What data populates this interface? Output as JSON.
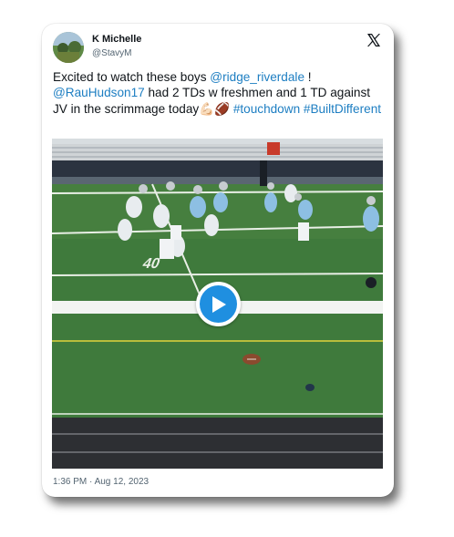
{
  "tweet": {
    "display_name": "K Michelle",
    "handle": "@StavyM",
    "text_parts": [
      {
        "text": "Excited to watch these boys ",
        "link": false
      },
      {
        "text": "@ridge_riverdale",
        "link": true
      },
      {
        "text": " ! ",
        "link": false
      },
      {
        "text": "@RauHudson17",
        "link": true
      },
      {
        "text": " had 2 TDs w freshmen and 1 TD against JV in the scrimmage today💪🏻🏈 ",
        "link": false
      },
      {
        "text": "#touchdown",
        "link": true
      },
      {
        "text": " ",
        "link": false
      },
      {
        "text": "#BuiltDifferent",
        "link": true
      }
    ],
    "timestamp": "1:36 PM · Aug 12, 2023"
  },
  "media": {
    "type": "video",
    "field_number": "40"
  },
  "icons": {
    "platform": "x-logo-icon",
    "play": "play-icon"
  },
  "colors": {
    "link": "#1d7ec2",
    "play_button": "#1f8fe0",
    "turf": "#3f7a3c"
  }
}
